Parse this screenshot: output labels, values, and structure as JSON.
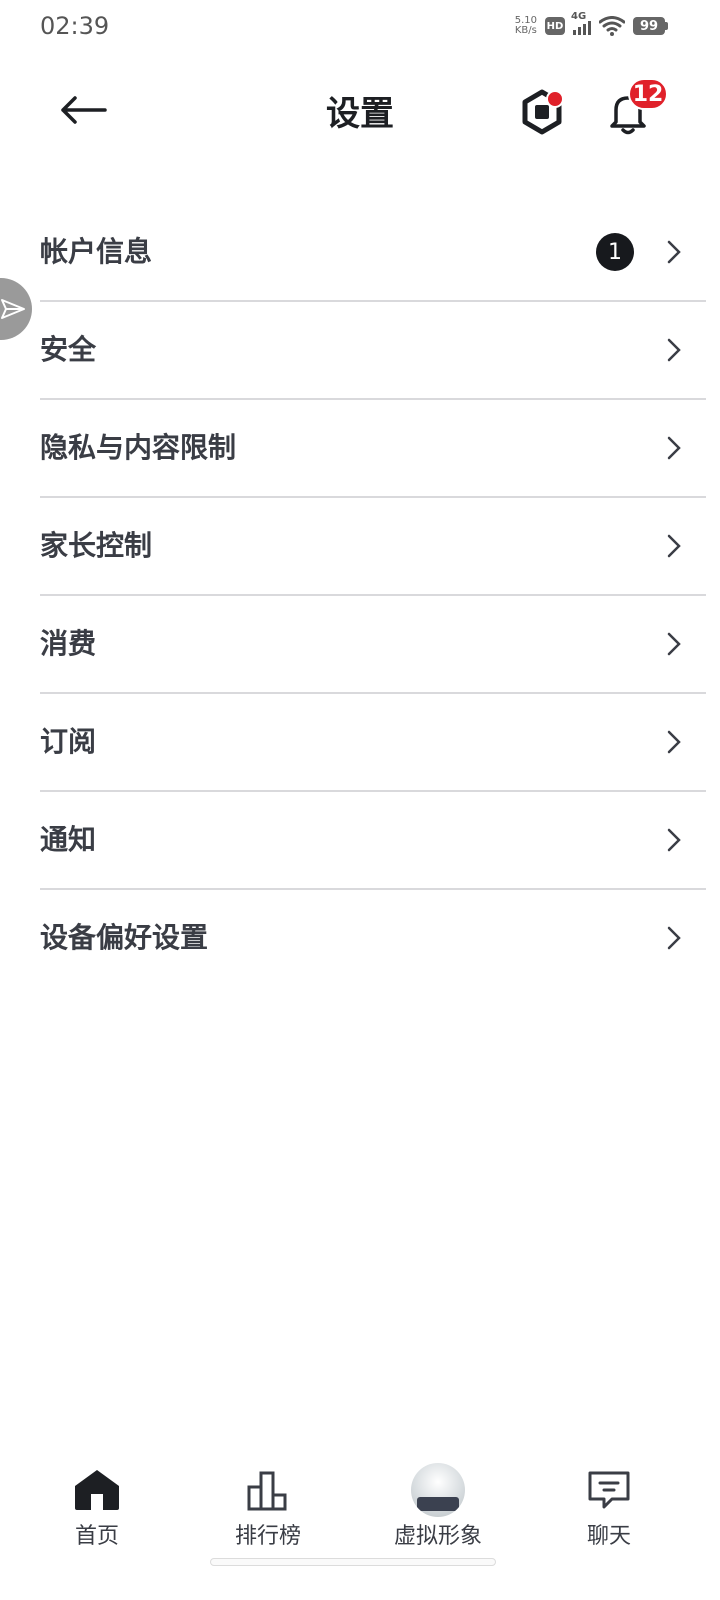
{
  "status_bar": {
    "time": "02:39",
    "net_speed_value": "5.10",
    "net_speed_unit": "KB/s",
    "hd": "HD",
    "network": "4G",
    "battery": "99"
  },
  "header": {
    "title": "设置",
    "back_icon": "arrow-left-icon",
    "currency_icon": "robux-icon",
    "notification_icon": "bell-icon",
    "notification_count": "12"
  },
  "settings": {
    "items": [
      {
        "label": "帐户信息",
        "badge": "1"
      },
      {
        "label": "安全"
      },
      {
        "label": "隐私与内容限制"
      },
      {
        "label": "家长控制"
      },
      {
        "label": "消费"
      },
      {
        "label": "订阅"
      },
      {
        "label": "通知"
      },
      {
        "label": "设备偏好设置"
      }
    ]
  },
  "bottom_nav": {
    "items": [
      {
        "label": "首页",
        "icon": "home-icon"
      },
      {
        "label": "排行榜",
        "icon": "leaderboard-icon"
      },
      {
        "label": "虚拟形象",
        "icon": "avatar-icon"
      },
      {
        "label": "聊天",
        "icon": "chat-icon"
      }
    ]
  },
  "colors": {
    "badge_red": "#e0212a",
    "text_primary": "#3a3d45",
    "divider": "#d9d9dc"
  }
}
